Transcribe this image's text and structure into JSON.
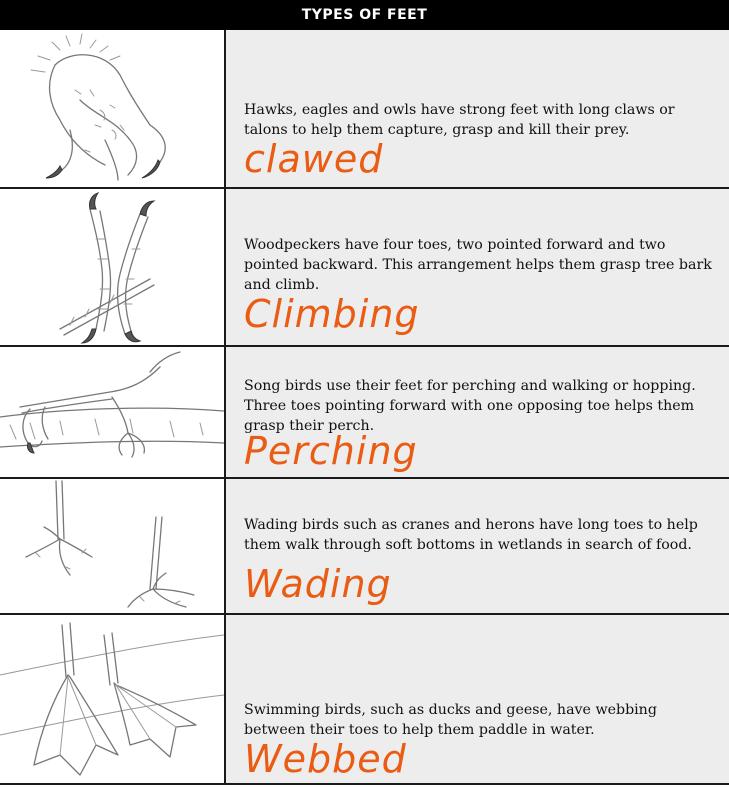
{
  "title": "TYPES OF FEET",
  "rows": [
    {
      "icon": "clawed-foot-sketch",
      "description": "Hawks, eagles and owls have strong feet with long claws or talons to help them capture, grasp and kill their prey.",
      "answer": "clawed"
    },
    {
      "icon": "climbing-foot-sketch",
      "description": "Woodpeckers have four toes, two pointed forward and two pointed backward.  This arrangement helps them grasp tree bark and climb.",
      "answer": "Climbing"
    },
    {
      "icon": "perching-foot-sketch",
      "description": "Song birds use their feet for perching and walking or hopping. Three toes pointing forward with one opposing toe helps them grasp their perch.",
      "answer": "Perching"
    },
    {
      "icon": "wading-foot-sketch",
      "description": "Wading birds such as cranes and herons have long toes to help them walk through soft bottoms in wetlands in search of food.",
      "answer": "Wading"
    },
    {
      "icon": "webbed-foot-sketch",
      "description": "Swimming birds, such as ducks and geese, have webbing between their toes to help them paddle in water.",
      "answer": "Webbed"
    }
  ],
  "colors": {
    "header_bg": "#000000",
    "text_cell_bg": "#ededed",
    "handwriting": "#ea5b13"
  }
}
